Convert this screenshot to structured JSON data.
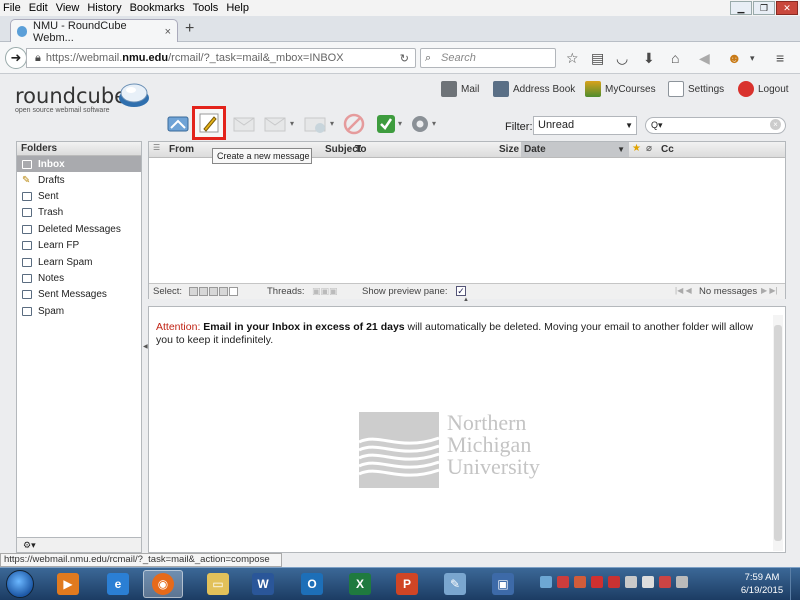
{
  "browser": {
    "menu": [
      "File",
      "Edit",
      "View",
      "History",
      "Bookmarks",
      "Tools",
      "Help"
    ],
    "tab_title": "NMU - RoundCube Webm...",
    "tab_close": "×",
    "newtab": "+",
    "url_prefix": "https://webmail.",
    "url_domain": "nmu.edu",
    "url_rest": "/rcmail/?_task=mail&_mbox=INBOX",
    "search_placeholder": "Search",
    "status_url": "https://webmail.nmu.edu/rcmail/?_task=mail&_action=compose"
  },
  "app": {
    "logo_word": "roundcube",
    "logo_tagline": "open source webmail software",
    "topnav": [
      {
        "label": "Mail",
        "icon": "gear-mail-icon",
        "color": "#6e7378"
      },
      {
        "label": "Address Book",
        "icon": "address-book-icon",
        "color": "#5a6f86"
      },
      {
        "label": "MyCourses",
        "icon": "mycourses-icon",
        "color": "#d9a21b"
      },
      {
        "label": "Settings",
        "icon": "settings-icon",
        "color": "#8d949b"
      },
      {
        "label": "Logout",
        "icon": "logout-icon",
        "color": "#d9322d"
      }
    ],
    "compose_tooltip": "Create a new message",
    "filter_label": "Filter:",
    "filter_value": "Unread",
    "mailsearch_value": "Q▾"
  },
  "folders": {
    "header": "Folders",
    "items": [
      {
        "label": "Inbox",
        "selected": true
      },
      {
        "label": "Drafts"
      },
      {
        "label": "Sent"
      },
      {
        "label": "Trash"
      },
      {
        "label": "Deleted Messages"
      },
      {
        "label": "Learn FP"
      },
      {
        "label": "Learn Spam"
      },
      {
        "label": "Notes"
      },
      {
        "label": "Sent Messages"
      },
      {
        "label": "Spam"
      }
    ],
    "footer": "⚙▾"
  },
  "messagelist": {
    "col_from": "From",
    "col_subject": "Subject",
    "col_to": "To",
    "col_size": "Size",
    "col_date": "Date",
    "col_cc": "Cc",
    "select_label": "Select:",
    "threads_label": "Threads:",
    "preview_label": "Show preview pane:",
    "no_messages": "No messages"
  },
  "preview": {
    "attention": "Attention:",
    "bold_part": "Email in your Inbox in excess of 21 days",
    "rest": " will automatically be deleted. Moving your email to another folder will allow you to keep it indefinitely.",
    "logo_line1": "Northern",
    "logo_line2": "Michigan",
    "logo_line3": "University"
  },
  "taskbar": {
    "time": "7:59 AM",
    "date": "6/19/2015"
  }
}
